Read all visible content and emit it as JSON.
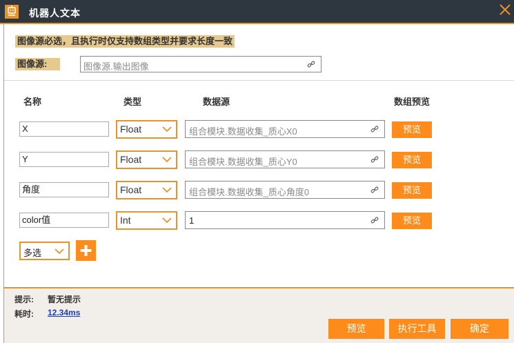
{
  "window": {
    "title": "机器人文本"
  },
  "note": "图像源必选，且执行时仅支持数组类型并要求长度一致",
  "image_source": {
    "label": "图像源:",
    "placeholder": "图像源.输出图像"
  },
  "columns": {
    "name": "名称",
    "type": "类型",
    "datasource": "数据源",
    "preview": "数组预览"
  },
  "rows": [
    {
      "name": "X",
      "type": "Float",
      "datasource": "组合模块.数据收集_质心X0",
      "preview": "预览"
    },
    {
      "name": "Y",
      "type": "Float",
      "datasource": "组合模块.数据收集_质心Y0",
      "preview": "预览"
    },
    {
      "name": "角度",
      "type": "Float",
      "datasource": "组合模块.数据收集_质心角度0",
      "preview": "预览"
    },
    {
      "name": "color值",
      "type": "Int",
      "datasource": "1",
      "preview": "预览"
    }
  ],
  "multi_select": "多选",
  "footer": {
    "hint_label": "提示:",
    "hint_value": "暂无提示",
    "time_label": "耗时:",
    "time_value": "12.34ms",
    "buttons": {
      "preview": "预览",
      "execute": "执行工具",
      "confirm": "确定"
    }
  },
  "colors": {
    "accent": "#fd8c1c",
    "titlebar": "#2e3640",
    "highlight": "#e6c98e"
  },
  "icons": {
    "logo": "robot-logo-icon",
    "close": "close-icon",
    "link": "link-icon",
    "dropdown": "chevron-down-icon",
    "add": "plus-icon"
  }
}
